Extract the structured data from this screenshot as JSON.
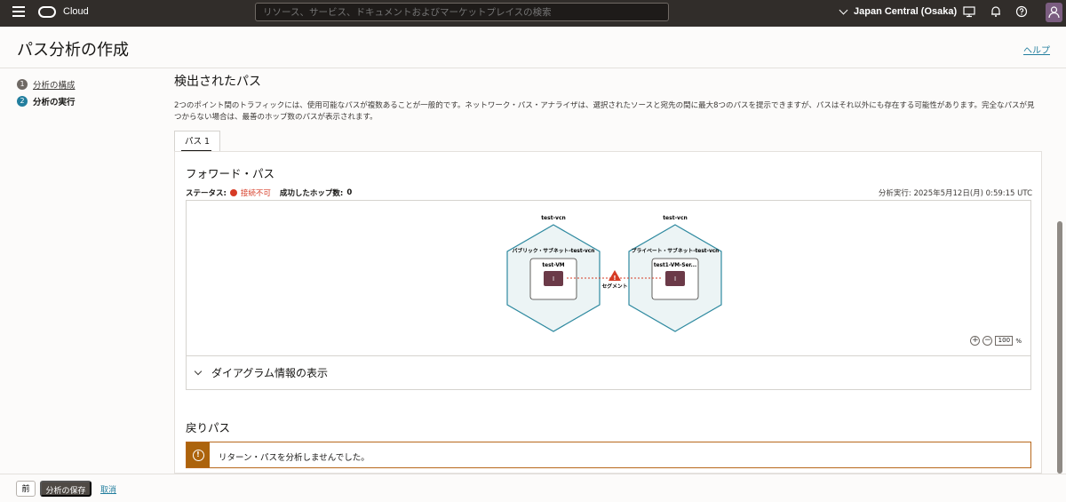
{
  "topbar": {
    "brand": "Cloud",
    "search_placeholder": "リソース、サービス、ドキュメントおよびマーケットプレイスの検索",
    "region": "Japan Central (Osaka)"
  },
  "header": {
    "title": "パス分析の作成",
    "help": "ヘルプ"
  },
  "steps": [
    {
      "num": "1",
      "label": "分析の構成"
    },
    {
      "num": "2",
      "label": "分析の実行"
    }
  ],
  "main": {
    "title": "検出されたパス",
    "description": "2つのポイント間のトラフィックには、使用可能なパスが複数あることが一般的です。ネットワーク・パス・アナライザは、選択されたソースと宛先の間に最大8つのパスを提示できますが、パスはそれ以外にも存在する可能性があります。完全なパスが見つからない場合は、最善のホップ数のパスが表示されます。",
    "tab": "パス 1",
    "forward": {
      "title": "フォワード・パス",
      "status_label": "ステータス:",
      "status_value": "接続不可",
      "hops_label": "成功したホップ数:",
      "hops_value": "0",
      "timestamp": "分析実行: 2025年5月12日(月) 0:59:15 UTC"
    },
    "diagram": {
      "left": {
        "vcn": "test-vcn",
        "subnet": "パブリック・サブネット-test-vcn",
        "instance": "test-VM"
      },
      "right": {
        "vcn": "test-vcn",
        "subnet": "プライベート・サブネット-test-vcn",
        "instance": "test1-VM-Ser..."
      },
      "segment": "セグメント",
      "zoom_value": "100",
      "zoom_unit": "%",
      "instance_glyph": "I",
      "warning_glyph": "!"
    },
    "diagram_info": "ダイアグラム情報の表示",
    "return": {
      "title": "戻りパス",
      "alert_glyph": "!",
      "alert": "リターン・パスを分析しませんでした。"
    }
  },
  "footer": {
    "prev": "前",
    "save": "分析の保存",
    "cancel": "取消"
  },
  "colors": {
    "accent": "#227e9e",
    "error": "#d63b25",
    "warning": "#ac630c",
    "topbar": "#312d2a",
    "hexagon_stroke": "#2f8aa0",
    "instance_fill": "#6b3a48"
  }
}
